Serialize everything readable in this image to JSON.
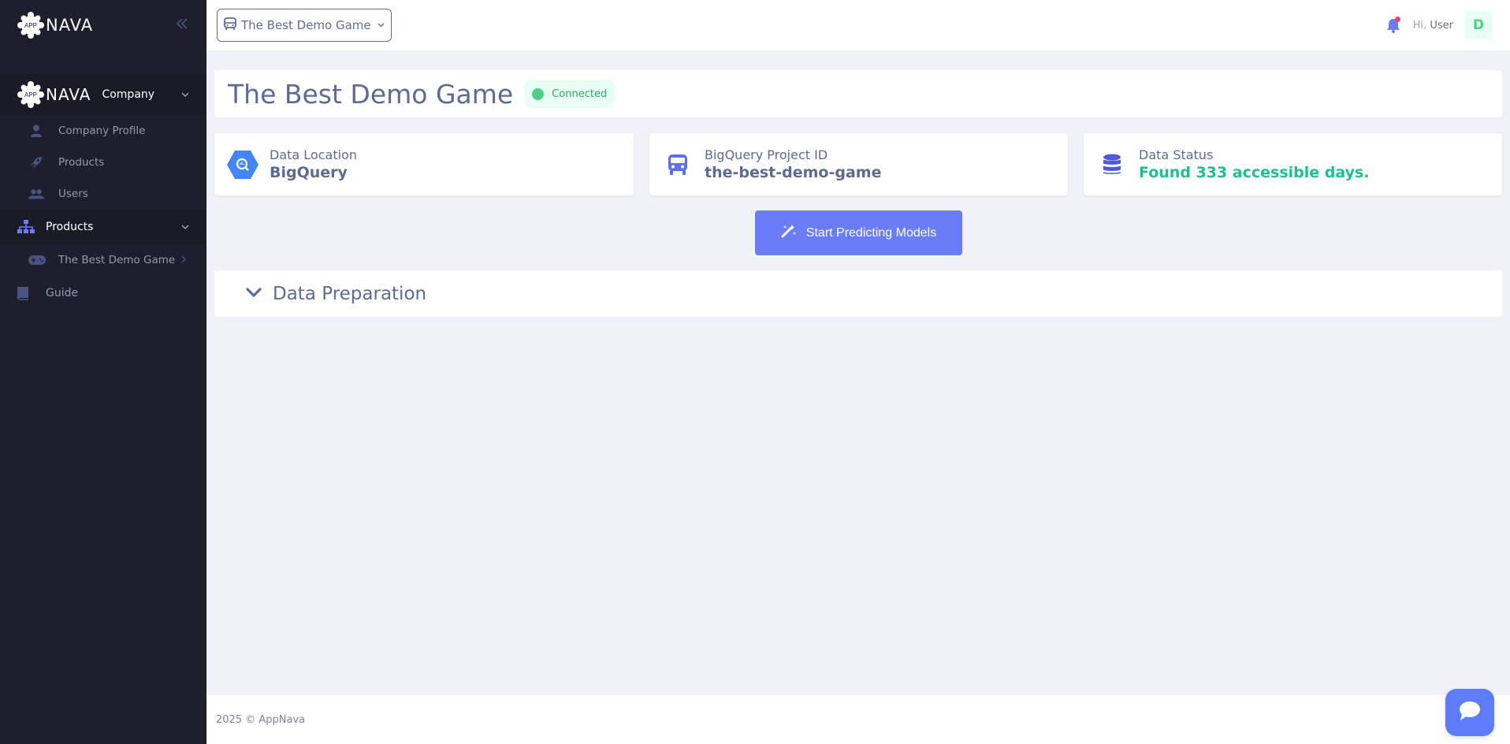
{
  "brand": {
    "logo_text": "NAVA",
    "logo_badge": "APP"
  },
  "sidebar": {
    "company_label": "Company",
    "company_items": [
      {
        "label": "Company Profile",
        "icon": "user-icon"
      },
      {
        "label": "Products",
        "icon": "rocket-icon"
      },
      {
        "label": "Users",
        "icon": "users-icon"
      }
    ],
    "products_group": {
      "label": "Products",
      "icon": "sitemap-icon"
    },
    "product_items": [
      {
        "label": "The Best Demo Game",
        "icon": "gamepad-icon"
      }
    ],
    "guide": {
      "label": "Guide",
      "icon": "book-icon"
    }
  },
  "topbar": {
    "selected_game": "The Best Demo Game",
    "greeting": "Hi,",
    "user_name": "User",
    "avatar_initial": "D"
  },
  "page": {
    "title": "The Best Demo Game",
    "status": "Connected"
  },
  "info_cards": [
    {
      "label": "Data Location",
      "value": "BigQuery",
      "icon": "bigquery-icon"
    },
    {
      "label": "BigQuery Project ID",
      "value": "the-best-demo-game",
      "icon": "bus-icon"
    },
    {
      "label": "Data Status",
      "value": "Found 333 accessible days.",
      "icon": "database-icon"
    }
  ],
  "cta_label": "Start Predicting Models",
  "section": {
    "label": "Data Preparation"
  },
  "footer": {
    "year": "2025",
    "copyright": "©",
    "company": "AppNava"
  },
  "colors": {
    "sidebar_bg": "#1e1e2d",
    "accent": "#6a7df6",
    "success": "#1bc08d",
    "title": "#5e6a91"
  }
}
